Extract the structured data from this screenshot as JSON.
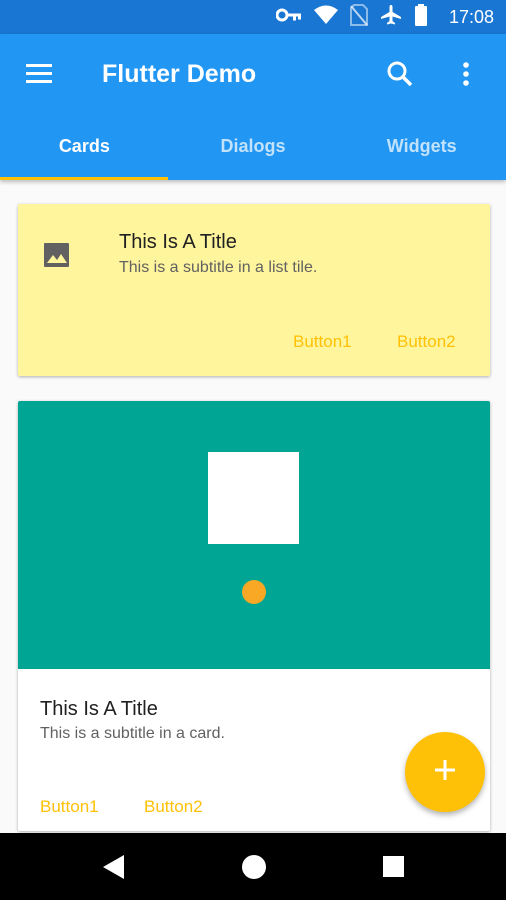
{
  "status_bar": {
    "time": "17:08",
    "icons": [
      "vpn-key-icon",
      "wifi-icon",
      "no-sim-icon",
      "airplane-mode-icon",
      "battery-icon"
    ]
  },
  "app_bar": {
    "title": "Flutter Demo",
    "menu_icon": "menu-icon",
    "search_icon": "search-icon",
    "more_icon": "more-vert-icon",
    "color": "#2196f3"
  },
  "tabs": [
    {
      "label": "Cards",
      "active": true
    },
    {
      "label": "Dialogs",
      "active": false
    },
    {
      "label": "Widgets",
      "active": false
    }
  ],
  "card1": {
    "icon": "image-icon",
    "title": "This Is A Title",
    "subtitle": "This is a subtitle in a list tile.",
    "button1": "Button1",
    "button2": "Button2",
    "color": "#fff59d"
  },
  "card2": {
    "media_color": "#00a693",
    "title": "This Is A Title",
    "subtitle": "This is a subtitle in a card.",
    "button1": "Button1",
    "button2": "Button2"
  },
  "fab": {
    "icon": "add-icon",
    "color": "#ffc107"
  },
  "nav_bar": {
    "icons": [
      "back-icon",
      "home-icon",
      "recents-icon"
    ]
  },
  "accent_color": "#ffc107"
}
